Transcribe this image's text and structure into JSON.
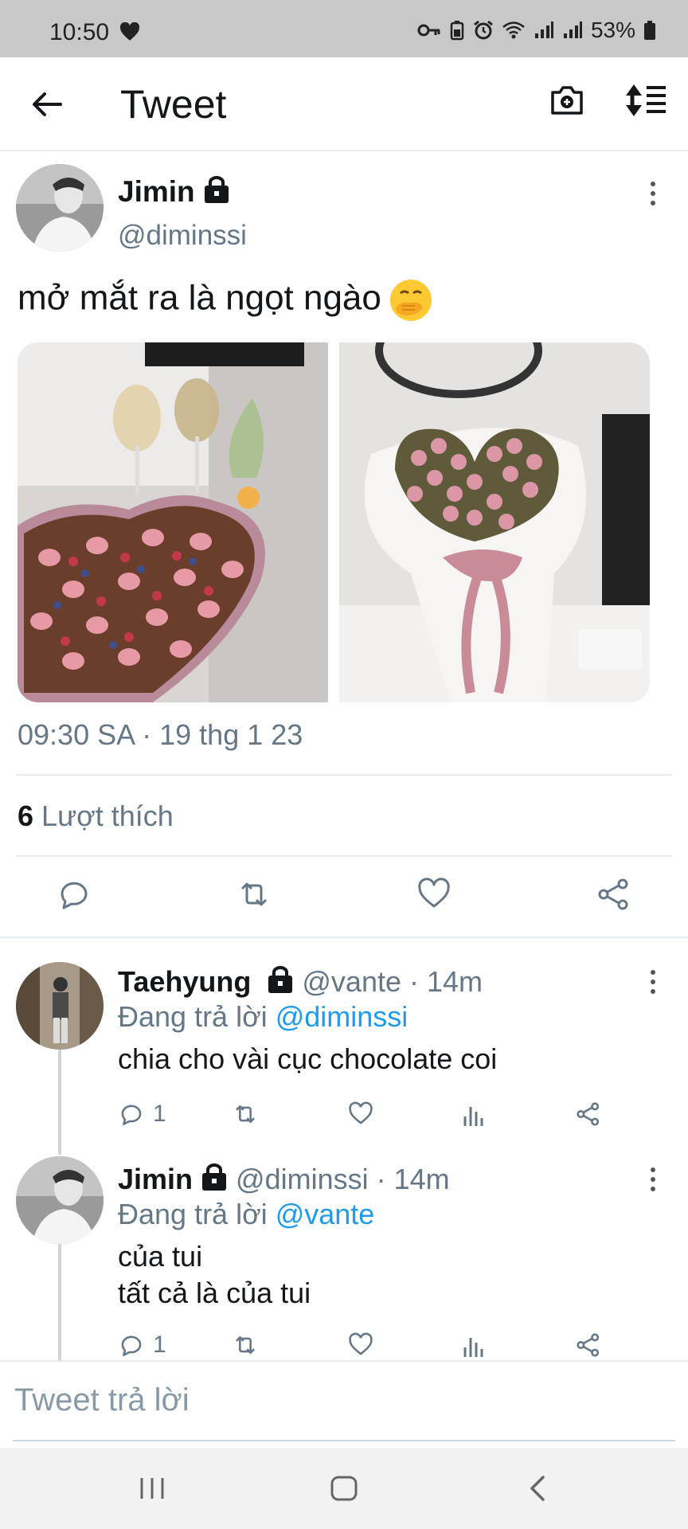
{
  "status_bar": {
    "time": "10:50",
    "battery": "53%"
  },
  "header": {
    "title": "Tweet"
  },
  "tweet": {
    "author_name": "Jimin",
    "author_handle": "@diminssi",
    "text": "mở mắt ra là ngọt ngào",
    "timestamp": "09:30 SA · 19 thg 1 23",
    "like_count": "6",
    "like_label": "Lượt thích"
  },
  "replies": [
    {
      "name": "Taehyung",
      "handle_time": "@vante · 14m",
      "replying_prefix": "Đang trả lời",
      "replying_to": "@diminssi",
      "text": "chia cho vài cục chocolate coi",
      "reply_count": "1"
    },
    {
      "name": "Jimin",
      "handle_time": "@diminssi · 14m",
      "replying_prefix": "Đang trả lời",
      "replying_to": "@vante",
      "text_line1": "của tui",
      "text_line2": "tất cả là của tui",
      "reply_count": "1"
    }
  ],
  "composer": {
    "placeholder": "Tweet trả lời"
  },
  "icons": {
    "back": "arrow-left-icon",
    "camera": "camera-plus-icon",
    "sort": "sort-icon",
    "reply": "comment-icon",
    "retweet": "retweet-icon",
    "like": "heart-icon",
    "share": "share-icon",
    "analytics": "analytics-icon",
    "lock": "lock-icon"
  },
  "colors": {
    "accent": "#1d9bf0",
    "secondary_text": "#657786",
    "divider": "#e6ecf0"
  }
}
